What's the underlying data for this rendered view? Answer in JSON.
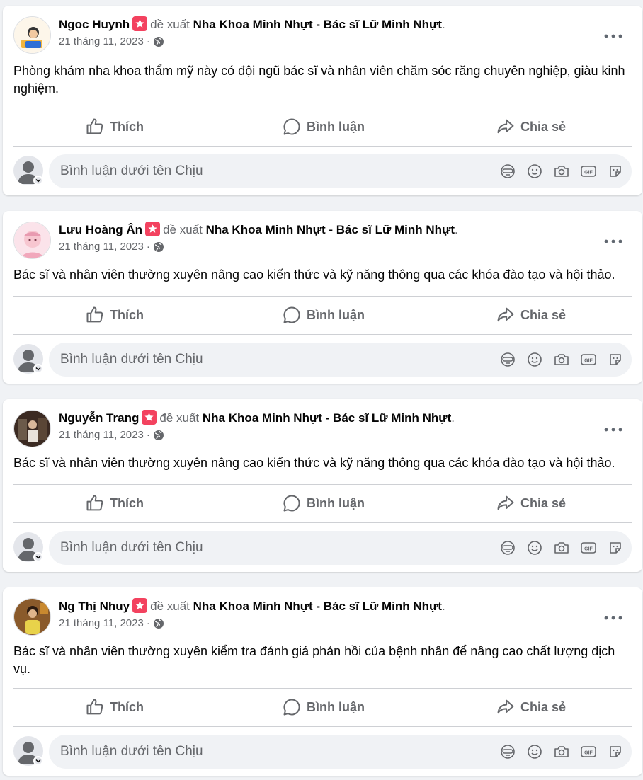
{
  "feed": {
    "posts": [
      {
        "author": "Ngoc Huynh",
        "verb": "đề xuất",
        "page": "Nha Khoa Minh Nhựt - Bác sĩ Lữ Minh Nhựt",
        "period": ".",
        "date": "21 tháng 11, 2023",
        "sep": "·",
        "text": "Phòng khám nha khoa thẩm mỹ này có đội ngũ bác sĩ và nhân viên chăm sóc răng chuyên nghiệp, giàu kinh nghiệm.",
        "avatar_color": "#f4b63f"
      },
      {
        "author": "Lưu Hoàng Ân",
        "verb": "đề xuất",
        "page": "Nha Khoa Minh Nhựt - Bác sĩ Lữ Minh Nhựt",
        "period": ".",
        "date": "21 tháng 11, 2023",
        "sep": "·",
        "text": "Bác sĩ và nhân viên thường xuyên nâng cao kiến thức và kỹ năng thông qua các khóa đào tạo và hội thảo.",
        "avatar_color": "#f7c6d0"
      },
      {
        "author": "Nguyễn Trang",
        "verb": "đề xuất",
        "page": "Nha Khoa Minh Nhựt - Bác sĩ Lữ Minh Nhựt",
        "period": ".",
        "date": "21 tháng 11, 2023",
        "sep": "·",
        "text": "Bác sĩ và nhân viên thường xuyên nâng cao kiến thức và kỹ năng thông qua các khóa đào tạo và hội thảo.",
        "avatar_color": "#3b2a22"
      },
      {
        "author": "Ng Thị Nhuy",
        "verb": "đề xuất",
        "page": "Nha Khoa Minh Nhựt - Bác sĩ Lữ Minh Nhựt",
        "period": ".",
        "date": "21 tháng 11, 2023",
        "sep": "·",
        "text": "Bác sĩ và nhân viên thường xuyên kiểm tra đánh giá phản hồi của bệnh nhân để nâng cao chất lượng dịch vụ.",
        "avatar_color": "#8a5a2b"
      }
    ],
    "actions": {
      "like": "Thích",
      "comment": "Bình luận",
      "share": "Chia sẻ"
    },
    "comment_placeholder": "Bình luận dưới tên Chịu",
    "icons": {
      "recommend_badge": "recommend-star-icon",
      "privacy": "globe-icon",
      "more": "more-options-icon",
      "like": "thumbs-up-icon",
      "comment": "speech-bubble-icon",
      "share": "share-arrow-icon",
      "tools": [
        "avatar-sticker-icon",
        "emoji-icon",
        "camera-icon",
        "gif-icon",
        "sticker-icon"
      ]
    },
    "colors": {
      "badge": "#f3425f",
      "secondary_text": "#65676b",
      "background": "#f0f2f5"
    }
  }
}
